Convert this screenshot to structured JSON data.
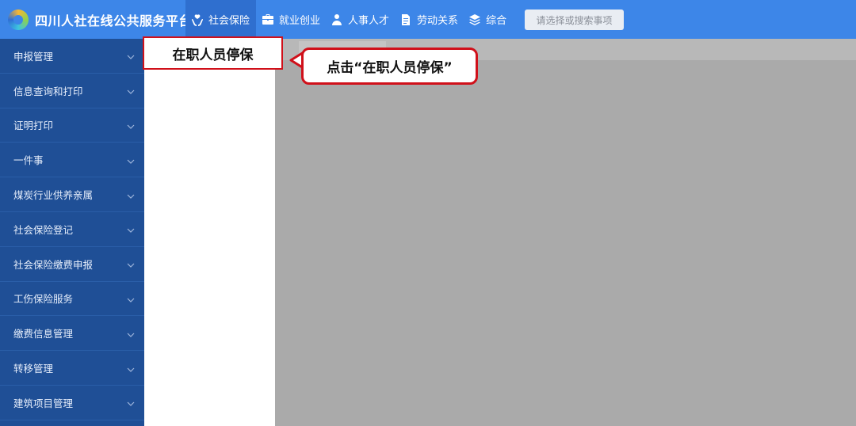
{
  "header": {
    "title": "四川人社在线公共服务平台",
    "logo_icon": "swirl-logo-icon",
    "nav": [
      {
        "label": "社会保险",
        "icon": "hands-heart-icon",
        "active": true
      },
      {
        "label": "就业创业",
        "icon": "briefcase-icon",
        "active": false
      },
      {
        "label": "人事人才",
        "icon": "people-icon",
        "active": false
      },
      {
        "label": "劳动关系",
        "icon": "document-icon",
        "active": false
      },
      {
        "label": "综合",
        "icon": "layers-icon",
        "active": false
      }
    ],
    "search_placeholder": "请选择或搜索事项"
  },
  "sidebar": {
    "items": [
      {
        "label": "申报管理"
      },
      {
        "label": "信息查询和打印"
      },
      {
        "label": "证明打印"
      },
      {
        "label": "一件事"
      },
      {
        "label": "煤炭行业供养亲属"
      },
      {
        "label": "社会保险登记"
      },
      {
        "label": "社会保险缴费申报"
      },
      {
        "label": "工伤保险服务"
      },
      {
        "label": "缴费信息管理"
      },
      {
        "label": "转移管理"
      },
      {
        "label": "建筑项目管理"
      }
    ]
  },
  "submenu": {
    "highlighted_item": "在职人员停保"
  },
  "annotation": {
    "text": "点击“在职人员停保”"
  },
  "colors": {
    "topbar": "#3d86e8",
    "topbar_active": "#2f6fcf",
    "sidebar": "#1f4f96",
    "highlight_border": "#d0101a",
    "content_bg": "#aaaaaa"
  }
}
